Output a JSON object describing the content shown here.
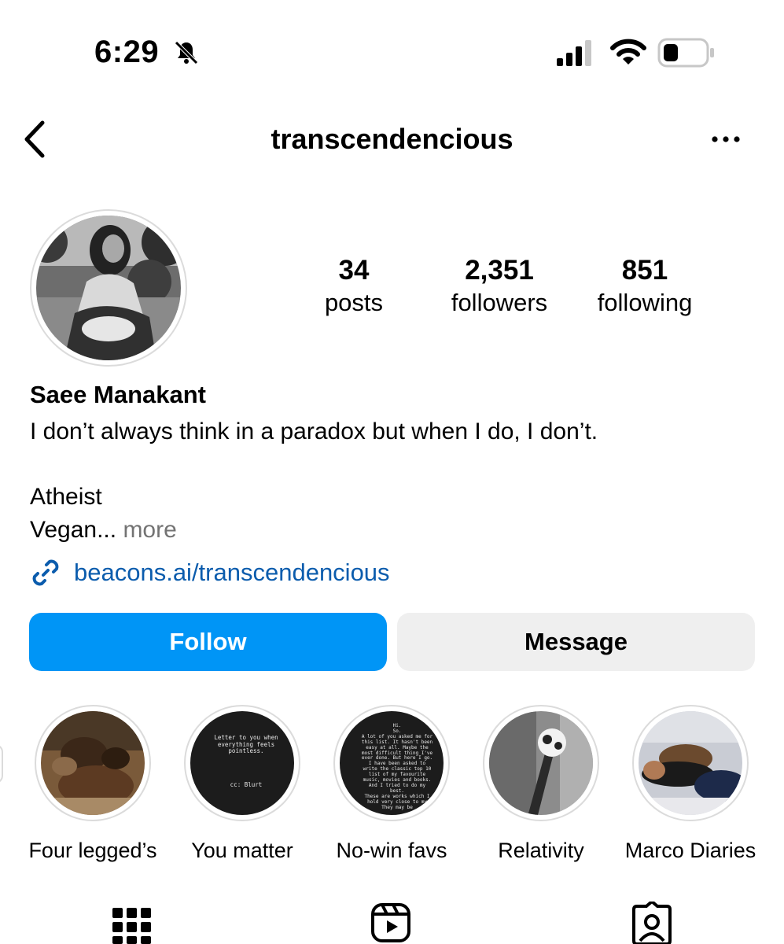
{
  "status_bar": {
    "time": "6:29",
    "icons": [
      "bell-slash-icon",
      "cellular-signal-icon",
      "wifi-icon",
      "battery-icon"
    ]
  },
  "nav": {
    "username": "transcendencious",
    "icons": [
      "back-chevron-icon",
      "more-dots-icon"
    ]
  },
  "profile": {
    "stats": [
      {
        "value": "34",
        "label": "posts"
      },
      {
        "value": "2,351",
        "label": "followers"
      },
      {
        "value": "851",
        "label": "following"
      }
    ],
    "full_name": "Saee Manakant",
    "bio_line1": "I don’t always think in a paradox but when I do, I don’t.",
    "bio_line2": "Atheist",
    "bio_line3": "Vegan...",
    "more_label": " more",
    "link": "beacons.ai/transcendencious"
  },
  "actions": {
    "follow_label": "Follow",
    "message_label": "Message",
    "colors": {
      "follow_bg": "#0095f6",
      "message_bg": "#efefef"
    }
  },
  "highlights": [
    {
      "name": "Four legged’s"
    },
    {
      "name": "You matter",
      "thumb_text": [
        "Letter to you when",
        "everything feels",
        "pointless.",
        "",
        "",
        "",
        "",
        "cc: Blurt"
      ]
    },
    {
      "name": "No-win favs",
      "thumb_text": [
        "Hi.",
        "So.",
        "A lot of you asked me for",
        "this list. It hasn't been",
        "easy at all. Maybe the",
        "most difficult thing I've",
        "ever done. But here I go.",
        "I have been asked to",
        "write the classic top 10",
        "list of my favourite",
        "music, movies and books.",
        "And I tried to do my",
        "best.",
        "These are works which I",
        "hold very close to my",
        "They may be"
      ]
    },
    {
      "name": "Relativity"
    },
    {
      "name": "Marco Diaries"
    }
  ],
  "bottom_tabs": [
    "grid-icon",
    "reels-icon",
    "tagged-icon"
  ]
}
